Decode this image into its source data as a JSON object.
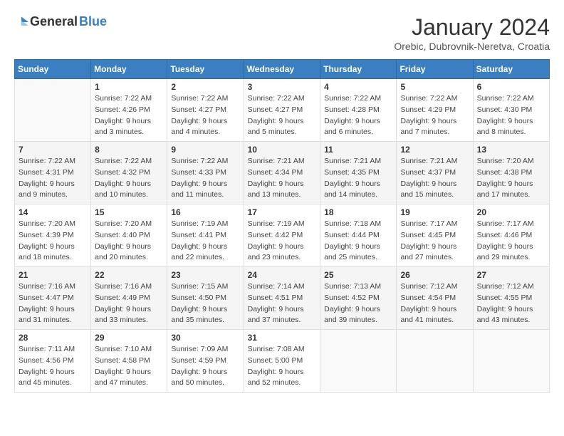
{
  "header": {
    "logo_general": "General",
    "logo_blue": "Blue",
    "title": "January 2024",
    "subtitle": "Orebic, Dubrovnik-Neretva, Croatia"
  },
  "columns": [
    "Sunday",
    "Monday",
    "Tuesday",
    "Wednesday",
    "Thursday",
    "Friday",
    "Saturday"
  ],
  "weeks": [
    [
      {
        "num": "",
        "sunrise": "",
        "sunset": "",
        "daylight": ""
      },
      {
        "num": "1",
        "sunrise": "Sunrise: 7:22 AM",
        "sunset": "Sunset: 4:26 PM",
        "daylight": "Daylight: 9 hours and 3 minutes."
      },
      {
        "num": "2",
        "sunrise": "Sunrise: 7:22 AM",
        "sunset": "Sunset: 4:27 PM",
        "daylight": "Daylight: 9 hours and 4 minutes."
      },
      {
        "num": "3",
        "sunrise": "Sunrise: 7:22 AM",
        "sunset": "Sunset: 4:27 PM",
        "daylight": "Daylight: 9 hours and 5 minutes."
      },
      {
        "num": "4",
        "sunrise": "Sunrise: 7:22 AM",
        "sunset": "Sunset: 4:28 PM",
        "daylight": "Daylight: 9 hours and 6 minutes."
      },
      {
        "num": "5",
        "sunrise": "Sunrise: 7:22 AM",
        "sunset": "Sunset: 4:29 PM",
        "daylight": "Daylight: 9 hours and 7 minutes."
      },
      {
        "num": "6",
        "sunrise": "Sunrise: 7:22 AM",
        "sunset": "Sunset: 4:30 PM",
        "daylight": "Daylight: 9 hours and 8 minutes."
      }
    ],
    [
      {
        "num": "7",
        "sunrise": "Sunrise: 7:22 AM",
        "sunset": "Sunset: 4:31 PM",
        "daylight": "Daylight: 9 hours and 9 minutes."
      },
      {
        "num": "8",
        "sunrise": "Sunrise: 7:22 AM",
        "sunset": "Sunset: 4:32 PM",
        "daylight": "Daylight: 9 hours and 10 minutes."
      },
      {
        "num": "9",
        "sunrise": "Sunrise: 7:22 AM",
        "sunset": "Sunset: 4:33 PM",
        "daylight": "Daylight: 9 hours and 11 minutes."
      },
      {
        "num": "10",
        "sunrise": "Sunrise: 7:21 AM",
        "sunset": "Sunset: 4:34 PM",
        "daylight": "Daylight: 9 hours and 13 minutes."
      },
      {
        "num": "11",
        "sunrise": "Sunrise: 7:21 AM",
        "sunset": "Sunset: 4:35 PM",
        "daylight": "Daylight: 9 hours and 14 minutes."
      },
      {
        "num": "12",
        "sunrise": "Sunrise: 7:21 AM",
        "sunset": "Sunset: 4:37 PM",
        "daylight": "Daylight: 9 hours and 15 minutes."
      },
      {
        "num": "13",
        "sunrise": "Sunrise: 7:20 AM",
        "sunset": "Sunset: 4:38 PM",
        "daylight": "Daylight: 9 hours and 17 minutes."
      }
    ],
    [
      {
        "num": "14",
        "sunrise": "Sunrise: 7:20 AM",
        "sunset": "Sunset: 4:39 PM",
        "daylight": "Daylight: 9 hours and 18 minutes."
      },
      {
        "num": "15",
        "sunrise": "Sunrise: 7:20 AM",
        "sunset": "Sunset: 4:40 PM",
        "daylight": "Daylight: 9 hours and 20 minutes."
      },
      {
        "num": "16",
        "sunrise": "Sunrise: 7:19 AM",
        "sunset": "Sunset: 4:41 PM",
        "daylight": "Daylight: 9 hours and 22 minutes."
      },
      {
        "num": "17",
        "sunrise": "Sunrise: 7:19 AM",
        "sunset": "Sunset: 4:42 PM",
        "daylight": "Daylight: 9 hours and 23 minutes."
      },
      {
        "num": "18",
        "sunrise": "Sunrise: 7:18 AM",
        "sunset": "Sunset: 4:44 PM",
        "daylight": "Daylight: 9 hours and 25 minutes."
      },
      {
        "num": "19",
        "sunrise": "Sunrise: 7:17 AM",
        "sunset": "Sunset: 4:45 PM",
        "daylight": "Daylight: 9 hours and 27 minutes."
      },
      {
        "num": "20",
        "sunrise": "Sunrise: 7:17 AM",
        "sunset": "Sunset: 4:46 PM",
        "daylight": "Daylight: 9 hours and 29 minutes."
      }
    ],
    [
      {
        "num": "21",
        "sunrise": "Sunrise: 7:16 AM",
        "sunset": "Sunset: 4:47 PM",
        "daylight": "Daylight: 9 hours and 31 minutes."
      },
      {
        "num": "22",
        "sunrise": "Sunrise: 7:16 AM",
        "sunset": "Sunset: 4:49 PM",
        "daylight": "Daylight: 9 hours and 33 minutes."
      },
      {
        "num": "23",
        "sunrise": "Sunrise: 7:15 AM",
        "sunset": "Sunset: 4:50 PM",
        "daylight": "Daylight: 9 hours and 35 minutes."
      },
      {
        "num": "24",
        "sunrise": "Sunrise: 7:14 AM",
        "sunset": "Sunset: 4:51 PM",
        "daylight": "Daylight: 9 hours and 37 minutes."
      },
      {
        "num": "25",
        "sunrise": "Sunrise: 7:13 AM",
        "sunset": "Sunset: 4:52 PM",
        "daylight": "Daylight: 9 hours and 39 minutes."
      },
      {
        "num": "26",
        "sunrise": "Sunrise: 7:12 AM",
        "sunset": "Sunset: 4:54 PM",
        "daylight": "Daylight: 9 hours and 41 minutes."
      },
      {
        "num": "27",
        "sunrise": "Sunrise: 7:12 AM",
        "sunset": "Sunset: 4:55 PM",
        "daylight": "Daylight: 9 hours and 43 minutes."
      }
    ],
    [
      {
        "num": "28",
        "sunrise": "Sunrise: 7:11 AM",
        "sunset": "Sunset: 4:56 PM",
        "daylight": "Daylight: 9 hours and 45 minutes."
      },
      {
        "num": "29",
        "sunrise": "Sunrise: 7:10 AM",
        "sunset": "Sunset: 4:58 PM",
        "daylight": "Daylight: 9 hours and 47 minutes."
      },
      {
        "num": "30",
        "sunrise": "Sunrise: 7:09 AM",
        "sunset": "Sunset: 4:59 PM",
        "daylight": "Daylight: 9 hours and 50 minutes."
      },
      {
        "num": "31",
        "sunrise": "Sunrise: 7:08 AM",
        "sunset": "Sunset: 5:00 PM",
        "daylight": "Daylight: 9 hours and 52 minutes."
      },
      {
        "num": "",
        "sunrise": "",
        "sunset": "",
        "daylight": ""
      },
      {
        "num": "",
        "sunrise": "",
        "sunset": "",
        "daylight": ""
      },
      {
        "num": "",
        "sunrise": "",
        "sunset": "",
        "daylight": ""
      }
    ]
  ]
}
